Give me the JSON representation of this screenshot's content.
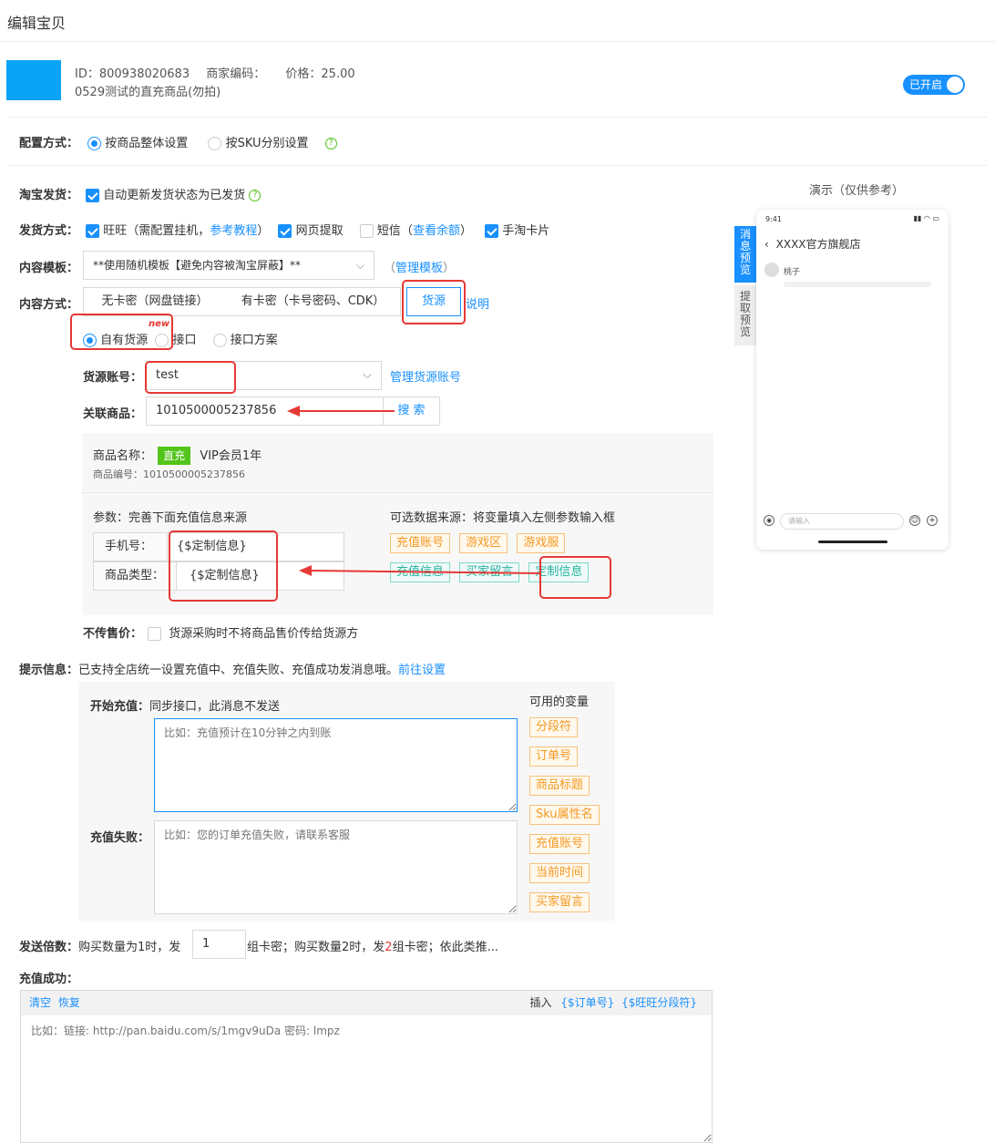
{
  "page": {
    "title": "编辑宝贝"
  },
  "product": {
    "id_label": "ID：800938020683",
    "merchant_code_label": "商家编码：",
    "price_label": "价格：25.00",
    "name": "0529测试的直充商品(勿拍)",
    "toggle_label": "已开启",
    "thumb_color": "#0aa3f5"
  },
  "config": {
    "label": "配置方式：",
    "options": [
      "按商品整体设置",
      "按SKU分别设置"
    ],
    "selected": 0
  },
  "taobao_ship": {
    "label": "淘宝发货：",
    "checkbox_label": "自动更新发货状态为已发货"
  },
  "ship_method": {
    "label": "发货方式：",
    "wangwang": "旺旺（需配置挂机，",
    "wangwang_link": "参考教程",
    "wangwang_end": "）",
    "web": "网页提取",
    "sms": "短信（",
    "sms_link": "查看余额",
    "sms_end": "）",
    "card": "手淘卡片"
  },
  "template": {
    "label": "内容模板：",
    "value": "**使用随机模板【避免内容被淘宝屏蔽】**",
    "manage_open": "（",
    "manage_link": "管理模板",
    "manage_close": "）"
  },
  "content_method": {
    "label": "内容方式：",
    "tabs": [
      "无卡密（网盘链接）",
      "有卡密（卡号密码、CDK）",
      "货源"
    ],
    "explain": "说明",
    "sub_options": [
      "自有货源",
      "接口",
      "接口方案"
    ],
    "new_badge": "new"
  },
  "source_account": {
    "label": "货源账号：",
    "value": "test",
    "manage_link": "管理货源账号"
  },
  "linked_product": {
    "label": "关联商品：",
    "value": "1010500005237856",
    "search": "搜 索"
  },
  "product_info": {
    "name_label": "商品名称：",
    "type_badge": "直充",
    "name": "VIP会员1年",
    "code_label": "商品编号：1010500005237856",
    "params_title": "参数：完善下面充值信息来源",
    "params": [
      {
        "label": "手机号：",
        "value": "{$定制信息}"
      },
      {
        "label": "商品类型：",
        "value": "{$定制信息}"
      }
    ],
    "sources_title": "可选数据来源：将变量填入左侧参数输入框",
    "sources_row1": [
      "充值账号",
      "游戏区",
      "游戏服"
    ],
    "sources_row2": [
      "充值信息",
      "买家留言",
      "定制信息"
    ]
  },
  "no_price": {
    "label": "不传售价：",
    "checkbox_label": "货源采购时不将商品售价传给货源方"
  },
  "tips": {
    "label": "提示信息：",
    "text": "已支持全店统一设置充值中、充值失败、充值成功发消息哦。",
    "link": "前往设置",
    "start_label": "开始充值：",
    "start_note": "同步接口，此消息不发送",
    "start_placeholder": "比如：充值预计在10分钟之内到账",
    "fail_label": "充值失败：",
    "fail_placeholder": "比如：您的订单充值失败，请联系客服",
    "vars_title": "可用的变量",
    "vars": [
      "分段符",
      "订单号",
      "商品标题",
      "Sku属性名",
      "充值账号",
      "当前时间",
      "买家留言"
    ]
  },
  "multiplier": {
    "label": "发送倍数：",
    "text1": "购买数量为1时，发",
    "value": "1",
    "text2": "组卡密；购买数量2时，发",
    "num": "2",
    "text3": "组卡密；依此类推..."
  },
  "success": {
    "label": "充值成功：",
    "clear": "清空",
    "restore": "恢复",
    "insert": "插入",
    "var1": "{$订单号}",
    "var2": "{$旺旺分段符}",
    "placeholder": "比如：链接: http://pan.baidu.com/s/1mgv9uDa 密码: lmpz"
  },
  "preview": {
    "title": "演示（仅供参考）",
    "tab_msg": "消息预览",
    "tab_extract": "提取预览",
    "time": "9:41",
    "shop": "XXXX官方旗舰店",
    "user": "桃子",
    "input_placeholder": "请输入"
  }
}
